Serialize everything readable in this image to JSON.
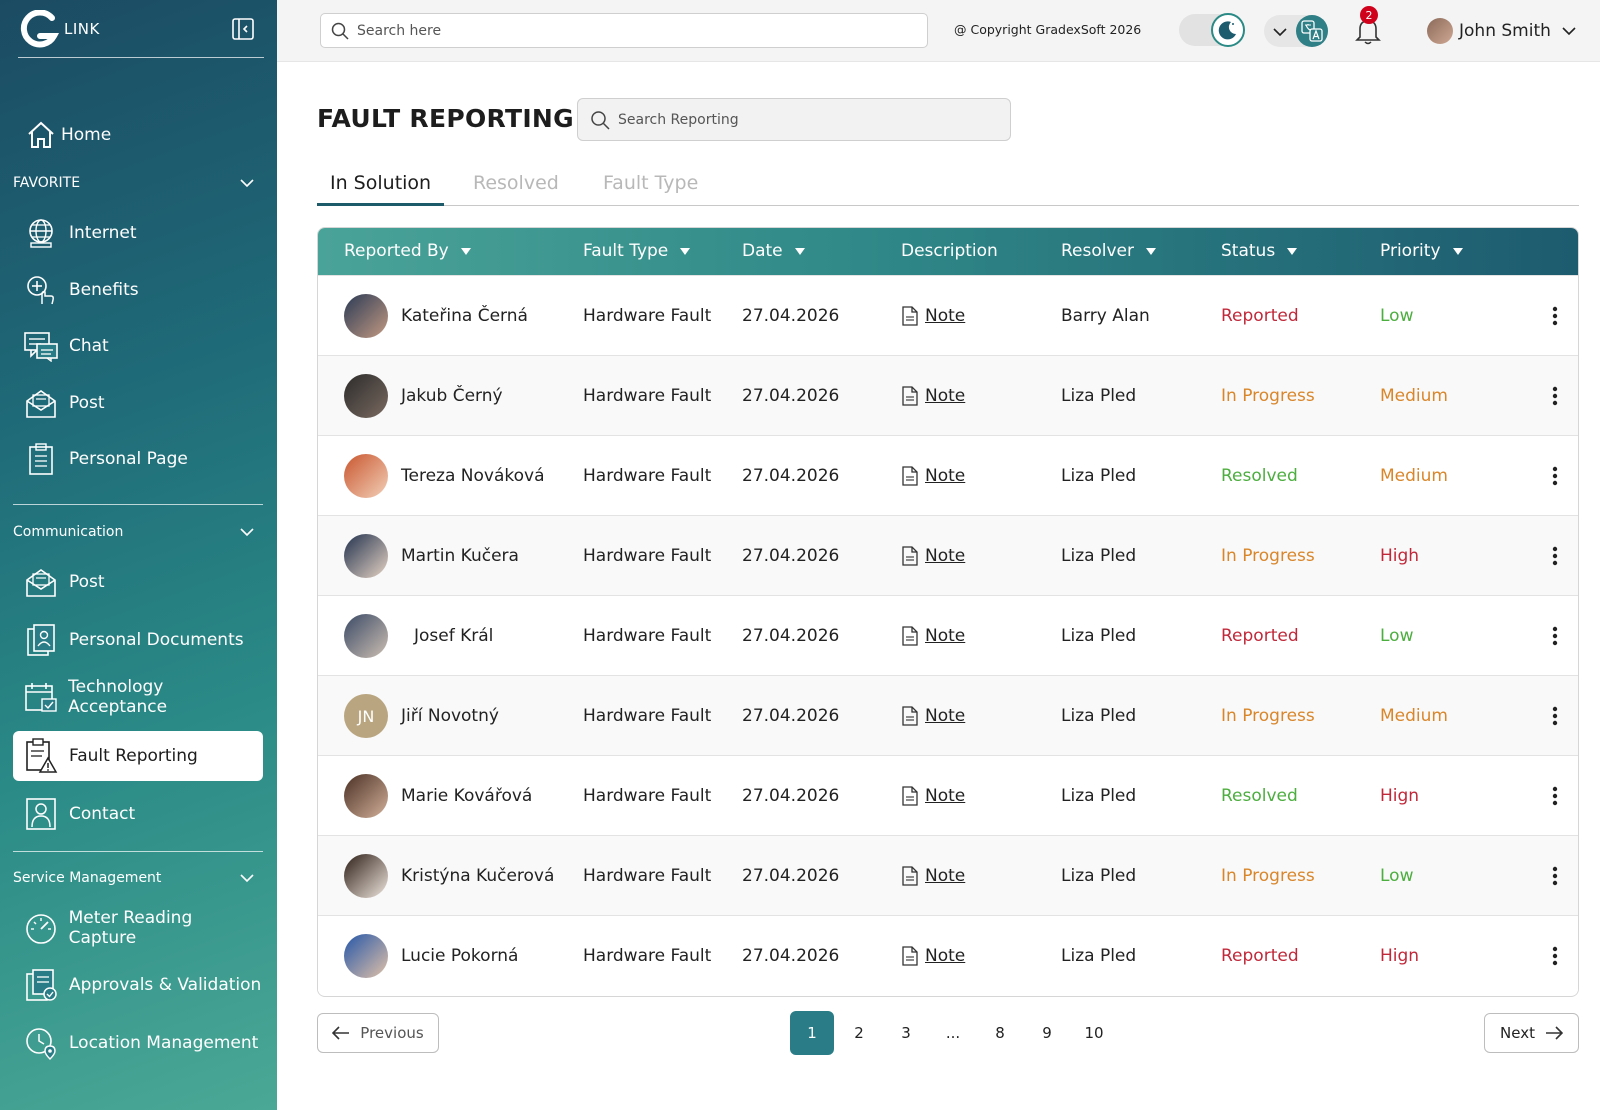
{
  "brand": {
    "logo_text": "LINK"
  },
  "sidebar": {
    "home": "Home",
    "favorite_label": "FAVORITE",
    "favorite_items": [
      "Internet",
      "Benefits",
      "Chat",
      "Post",
      "Personal Page"
    ],
    "communication_label": "Communication",
    "communication_items": [
      "Post",
      "Personal Documents",
      "Technology Acceptance",
      "Fault Reporting",
      "Contact"
    ],
    "service_label": "Service Management",
    "service_items": [
      "Meter Reading Capture",
      "Approvals & Validation",
      "Location Management"
    ],
    "active_item": "Fault Reporting"
  },
  "topbar": {
    "search_placeholder": "Search here",
    "copyright": "@ Copyright GradexSoft 2026",
    "notification_count": "2",
    "user_name": "John Smith"
  },
  "page": {
    "title": "FAULT REPORTING",
    "search_placeholder": "Search Reporting",
    "tabs": [
      "In Solution",
      "Resolved",
      "Fault Type"
    ],
    "active_tab": "In Solution"
  },
  "table": {
    "columns": [
      "Reported By",
      "Fault Type",
      "Date",
      "Description",
      "Resolver",
      "Status",
      "Priority"
    ],
    "rows": [
      {
        "name": "Kateřina Černá",
        "fault": "Hardware Fault",
        "date": "27.04.2026",
        "desc": "Note",
        "resolver": "Barry Alan",
        "status": "Reported",
        "priority": "Low"
      },
      {
        "name": "Jakub Černý",
        "fault": "Hardware Fault",
        "date": "27.04.2026",
        "desc": "Note",
        "resolver": "Liza Pled",
        "status": "In Progress",
        "priority": "Medium"
      },
      {
        "name": "Tereza Nováková",
        "fault": "Hardware Fault",
        "date": "27.04.2026",
        "desc": "Note",
        "resolver": "Liza Pled",
        "status": "Resolved",
        "priority": "Medium"
      },
      {
        "name": "Martin Kučera",
        "fault": "Hardware Fault",
        "date": "27.04.2026",
        "desc": "Note",
        "resolver": "Liza Pled",
        "status": "In Progress",
        "priority": "High"
      },
      {
        "name": "Josef Král",
        "fault": "Hardware Fault",
        "date": "27.04.2026",
        "desc": "Note",
        "resolver": "Liza Pled",
        "status": "Reported",
        "priority": "Low"
      },
      {
        "name": "Jiří Novotný",
        "initials": "JN",
        "fault": "Hardware Fault",
        "date": "27.04.2026",
        "desc": "Note",
        "resolver": "Liza Pled",
        "status": "In Progress",
        "priority": "Medium"
      },
      {
        "name": "Marie Kovářová",
        "fault": "Hardware Fault",
        "date": "27.04.2026",
        "desc": "Note",
        "resolver": "Liza Pled",
        "status": "Resolved",
        "priority": "Hign"
      },
      {
        "name": "Kristýna Kučerová",
        "fault": "Hardware Fault",
        "date": "27.04.2026",
        "desc": "Note",
        "resolver": "Liza Pled",
        "status": "In Progress",
        "priority": "Low"
      },
      {
        "name": "Lucie Pokorná",
        "fault": "Hardware Fault",
        "date": "27.04.2026",
        "desc": "Note",
        "resolver": "Liza Pled",
        "status": "Reported",
        "priority": "Hign"
      }
    ]
  },
  "pagination": {
    "previous": "Previous",
    "next": "Next",
    "pages": [
      "1",
      "2",
      "3",
      "...",
      "8",
      "9",
      "10"
    ],
    "current": "1"
  },
  "colors": {
    "status_reported": "#c0283a",
    "status_in_progress": "#d9862a",
    "status_resolved": "#4cae3e",
    "priority_low": "#4cae3e",
    "priority_medium": "#d9862a",
    "priority_high": "#c0283a",
    "accent": "#2a7d86"
  }
}
